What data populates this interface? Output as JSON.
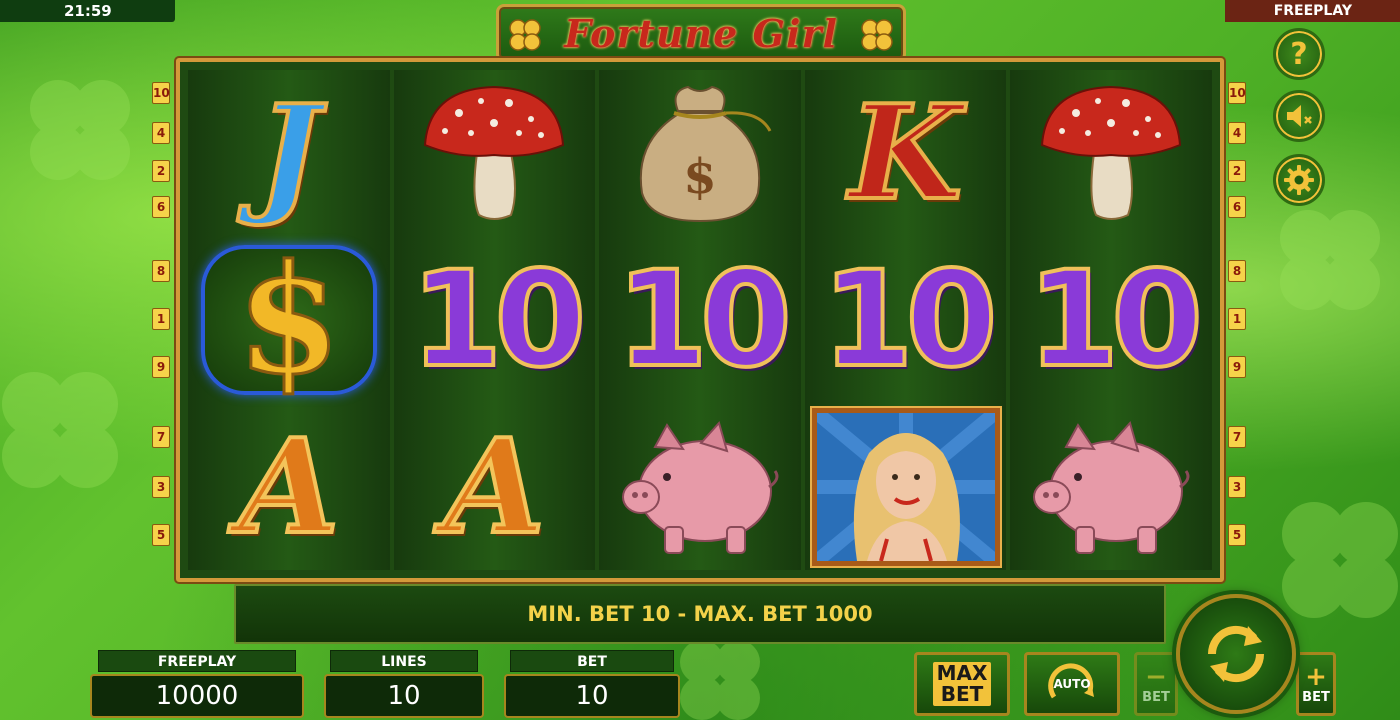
{
  "status_bar": {
    "time": "21:59",
    "mode": "FREEPLAY"
  },
  "game": {
    "title": "Fortune Girl"
  },
  "paylines": {
    "left": [
      "10",
      "4",
      "2",
      "6",
      "8",
      "1",
      "9",
      "7",
      "3",
      "5"
    ],
    "right": [
      "10",
      "4",
      "2",
      "6",
      "8",
      "1",
      "9",
      "7",
      "3",
      "5"
    ]
  },
  "reels": [
    [
      "J",
      "$",
      "A"
    ],
    [
      "mushroom",
      "10",
      "A"
    ],
    [
      "money-bag",
      "10",
      "piggy-bank"
    ],
    [
      "K",
      "10",
      "fortune-girl"
    ],
    [
      "mushroom",
      "10",
      "piggy-bank"
    ]
  ],
  "info_message": "MIN. BET 10 - MAX. BET 1000",
  "panels": {
    "balance": {
      "label": "FREEPLAY",
      "value": "10000"
    },
    "lines": {
      "label": "LINES",
      "value": "10"
    },
    "bet": {
      "label": "BET",
      "value": "10"
    }
  },
  "controls": {
    "max_bet_line1": "MAX",
    "max_bet_line2": "BET",
    "auto_label": "AUTO",
    "bet_minus_label": "BET",
    "bet_plus_label": "BET",
    "minus_symbol": "−",
    "plus_symbol": "+",
    "help_symbol": "?"
  },
  "colors": {
    "gold": "#f2c23a",
    "accent_red": "#c8281c",
    "info_text": "#f3d24a"
  }
}
